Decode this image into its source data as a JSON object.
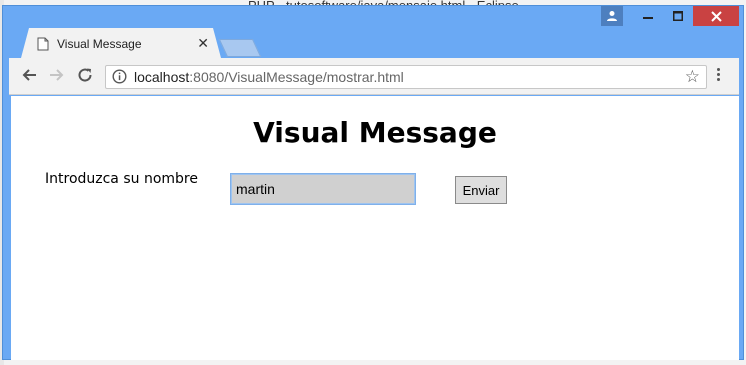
{
  "background_window": {
    "title": "PHP - tutosoftware/java/mensaje.html - Eclipse"
  },
  "browser": {
    "tab": {
      "title": "Visual Message"
    },
    "address": {
      "host": "localhost",
      "rest": ":8080/VisualMessage/mostrar.html"
    }
  },
  "page": {
    "heading": "Visual Message",
    "name_label": "Introduzca su nombre",
    "name_value": "martin",
    "submit_label": "Enviar"
  },
  "colors": {
    "titlebar": "#6aa9f4",
    "close_button": "#c94242",
    "input_background": "#d0d0d0"
  }
}
